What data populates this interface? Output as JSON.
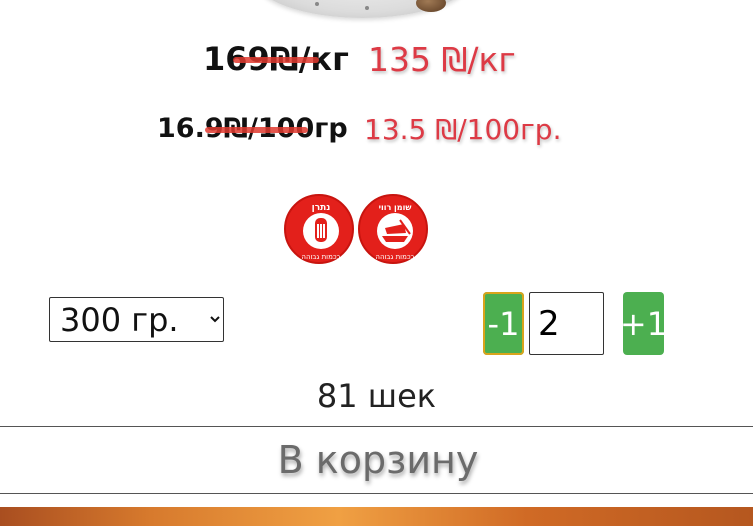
{
  "prices": {
    "per_kg": {
      "old": "169₪/кг",
      "new": "135 ₪/кг"
    },
    "per_100g": {
      "old": "16.9₪/100гр",
      "new": "13.5 ₪/100гр."
    }
  },
  "badges": [
    {
      "name": "sodium-badge",
      "top_text": "נתרן",
      "bottom_text": "בכמות גבוהה",
      "icon": "salt-shaker-icon"
    },
    {
      "name": "saturated-fat-badge",
      "top_text": "שומן רווי",
      "bottom_text": "בכמות גבוהה",
      "icon": "butter-icon"
    }
  ],
  "weight_select": {
    "selected": "300 гр."
  },
  "quantity": {
    "minus_label": "-1",
    "value": "2",
    "plus_label": "+1"
  },
  "total": "81 шек",
  "cart_button_label": "В корзину",
  "colors": {
    "accent_red": "#dd3a45",
    "badge_red": "#e3201b",
    "qty_green": "#4caf50"
  }
}
